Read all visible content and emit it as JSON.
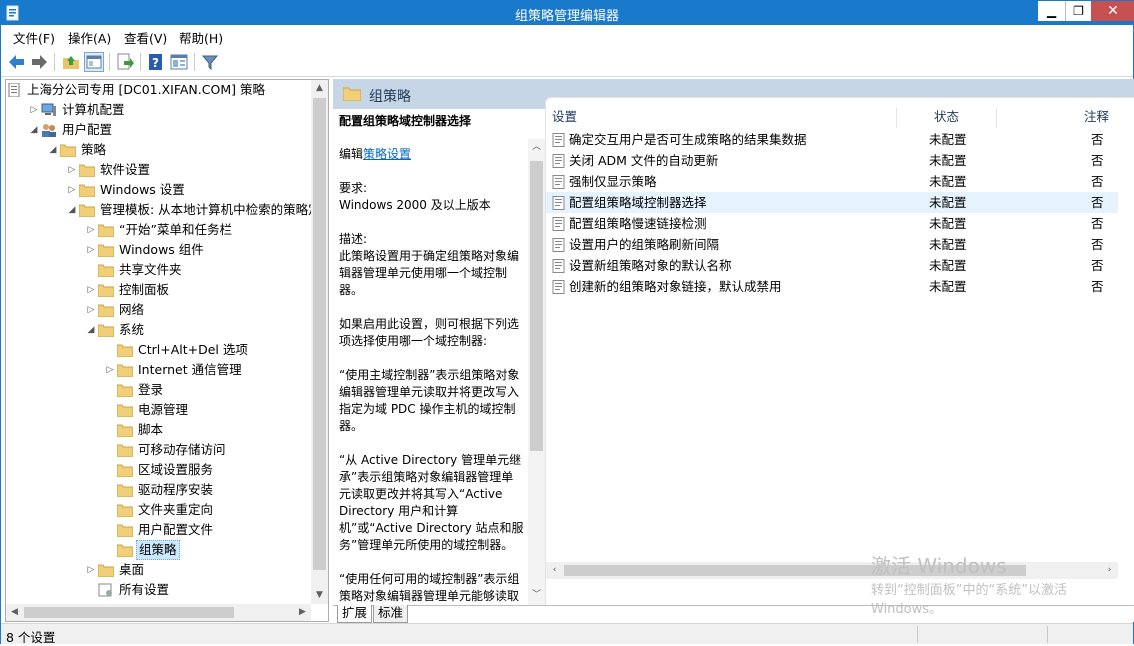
{
  "window": {
    "title": "组策略管理编辑器"
  },
  "menu": [
    "文件(F)",
    "操作(A)",
    "查看(V)",
    "帮助(H)"
  ],
  "tree": [
    {
      "label": "上海分公司专用 [DC01.XIFAN.COM] 策略",
      "indent": 0,
      "exp": "",
      "icon": "policy-doc-icon"
    },
    {
      "label": "计算机配置",
      "indent": 1,
      "exp": "▷",
      "icon": "computer-icon"
    },
    {
      "label": "用户配置",
      "indent": 1,
      "exp": "◢",
      "icon": "users-icon"
    },
    {
      "label": "策略",
      "indent": 2,
      "exp": "◢",
      "icon": "folder-icon"
    },
    {
      "label": "软件设置",
      "indent": 3,
      "exp": "▷",
      "icon": "folder-icon"
    },
    {
      "label": "Windows 设置",
      "indent": 3,
      "exp": "▷",
      "icon": "folder-icon"
    },
    {
      "label": "管理模板: 从本地计算机中检索的策略定义",
      "indent": 3,
      "exp": "◢",
      "icon": "folder-icon"
    },
    {
      "label": "“开始”菜单和任务栏",
      "indent": 4,
      "exp": "▷",
      "icon": "folder-icon"
    },
    {
      "label": "Windows 组件",
      "indent": 4,
      "exp": "▷",
      "icon": "folder-icon"
    },
    {
      "label": "共享文件夹",
      "indent": 4,
      "exp": "",
      "icon": "folder-icon"
    },
    {
      "label": "控制面板",
      "indent": 4,
      "exp": "▷",
      "icon": "folder-icon"
    },
    {
      "label": "网络",
      "indent": 4,
      "exp": "▷",
      "icon": "folder-icon"
    },
    {
      "label": "系统",
      "indent": 4,
      "exp": "◢",
      "icon": "folder-icon"
    },
    {
      "label": "Ctrl+Alt+Del 选项",
      "indent": 5,
      "exp": "",
      "icon": "folder-icon"
    },
    {
      "label": "Internet 通信管理",
      "indent": 5,
      "exp": "▷",
      "icon": "folder-icon"
    },
    {
      "label": "登录",
      "indent": 5,
      "exp": "",
      "icon": "folder-icon"
    },
    {
      "label": "电源管理",
      "indent": 5,
      "exp": "",
      "icon": "folder-icon"
    },
    {
      "label": "脚本",
      "indent": 5,
      "exp": "",
      "icon": "folder-icon"
    },
    {
      "label": "可移动存储访问",
      "indent": 5,
      "exp": "",
      "icon": "folder-icon"
    },
    {
      "label": "区域设置服务",
      "indent": 5,
      "exp": "",
      "icon": "folder-icon"
    },
    {
      "label": "驱动程序安装",
      "indent": 5,
      "exp": "",
      "icon": "folder-icon"
    },
    {
      "label": "文件夹重定向",
      "indent": 5,
      "exp": "",
      "icon": "folder-icon"
    },
    {
      "label": "用户配置文件",
      "indent": 5,
      "exp": "",
      "icon": "folder-icon"
    },
    {
      "label": "组策略",
      "indent": 5,
      "exp": "",
      "icon": "folder-icon",
      "selected": true
    },
    {
      "label": "桌面",
      "indent": 4,
      "exp": "▷",
      "icon": "folder-icon"
    },
    {
      "label": "所有设置",
      "indent": 4,
      "exp": "",
      "icon": "all-settings-icon"
    }
  ],
  "right": {
    "header": "组策略",
    "desc": {
      "title": "配置组策略域控制器选择",
      "edit_prefix": "编辑",
      "edit_link": "策略设置",
      "req_label": "要求:",
      "req_value": "Windows 2000 及以上版本",
      "desc_label": "描述:",
      "p1": "此策略设置用于确定组策略对象编辑器管理单元使用哪一个域控制器。",
      "p2": "如果启用此设置，则可根据下列选项选择使用哪一个域控制器:",
      "p3": "“使用主域控制器”表示组策略对象编辑器管理单元读取并将更改写入指定为域 PDC 操作主机的域控制器。",
      "p4": "“从 Active Directory 管理单元继承”表示组策略对象编辑器管理单元读取更改并将其写入“Active Directory 用户和计算机”或“Active Directory 站点和服务”管理单元所使用的域控制器。",
      "p5": "“使用任何可用的域控制器”表示组策略对象编辑器管理单元能够读取"
    },
    "columns": [
      "设置",
      "状态",
      "注释"
    ],
    "rows": [
      {
        "setting": "确定交互用户是否可生成策略的结果集数据",
        "state": "未配置",
        "note": "否"
      },
      {
        "setting": "关闭 ADM 文件的自动更新",
        "state": "未配置",
        "note": "否"
      },
      {
        "setting": "强制仅显示策略",
        "state": "未配置",
        "note": "否"
      },
      {
        "setting": "配置组策略域控制器选择",
        "state": "未配置",
        "note": "否",
        "selected": true
      },
      {
        "setting": "配置组策略慢速链接检测",
        "state": "未配置",
        "note": "否"
      },
      {
        "setting": "设置用户的组策略刷新间隔",
        "state": "未配置",
        "note": "否"
      },
      {
        "setting": "设置新组策略对象的默认名称",
        "state": "未配置",
        "note": "否"
      },
      {
        "setting": "创建新的组策略对象链接，默认成禁用",
        "state": "未配置",
        "note": "否"
      }
    ],
    "tabs": [
      "扩展",
      "标准"
    ]
  },
  "status": "8 个设置",
  "watermark": {
    "line1": "激活 Windows",
    "line2": "转到“控制面板”中的“系统”以激活",
    "line3": "Windows。"
  },
  "colors": {
    "titlebar": "#1979ca",
    "header": "#c7d6e7",
    "selection": "#cce8ff",
    "close": "#c75050"
  }
}
